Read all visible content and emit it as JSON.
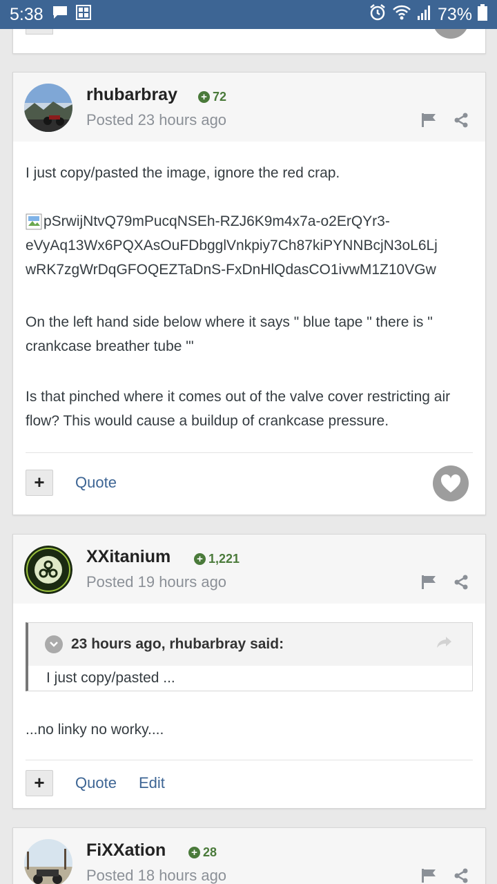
{
  "status_bar": {
    "time": "5:38",
    "battery": "73%",
    "bg_color": "#3d6594"
  },
  "posts": [
    {
      "author": "rhubarbray",
      "reputation": "72",
      "posted": "Posted 23 hours ago",
      "body": [
        "I just copy/pasted the image, ignore the red crap.",
        "pSrwijNtvQ79mPucqNSEh-RZJ6K9m4x7a-o2ErQYr3-eVyAq13Wx6PQXAsOuFDbgglVnkpiy7Ch87kiPYNNBcjN3oL6LjwRK7zgWrDqGFOQEZTaDnS-FxDnHlQdasCO1ivwM1Z10VGw",
        "On the left hand side below where it says \" blue tape \" there is \" crankcase breather tube \"'",
        "Is that pinched where it comes out of the valve cover restricting air flow? This would cause a buildup of crankcase pressure."
      ],
      "broken_image_lines": [
        "pSrwijNtvQ79mPucqNSEh-RZJ6K9m4x7a-o2ErQYr3-",
        "eVyAq13Wx6PQXAsOuFDbgglVnkpiy7Ch87kiPYNNBcjN3oL6Lj",
        "wRK7zgWrDqGFOQEZTaDnS-FxDnHlQdasCO1ivwM1Z10VGw"
      ],
      "actions": {
        "plus": "+",
        "quote": "Quote"
      }
    },
    {
      "author": "XXitanium",
      "reputation": "1,221",
      "posted": "Posted 19 hours ago",
      "quote": {
        "header": "23 hours ago, rhubarbray said:",
        "text": "I just copy/pasted ..."
      },
      "body": [
        "...no linky no worky...."
      ],
      "actions": {
        "plus": "+",
        "quote": "Quote",
        "edit": "Edit"
      }
    },
    {
      "author": "FiXXation",
      "reputation": "28",
      "posted": "Posted 18 hours ago"
    }
  ],
  "colors": {
    "link": "#3d6594",
    "reputation": "#4a7a3a",
    "muted": "#8b9097"
  }
}
